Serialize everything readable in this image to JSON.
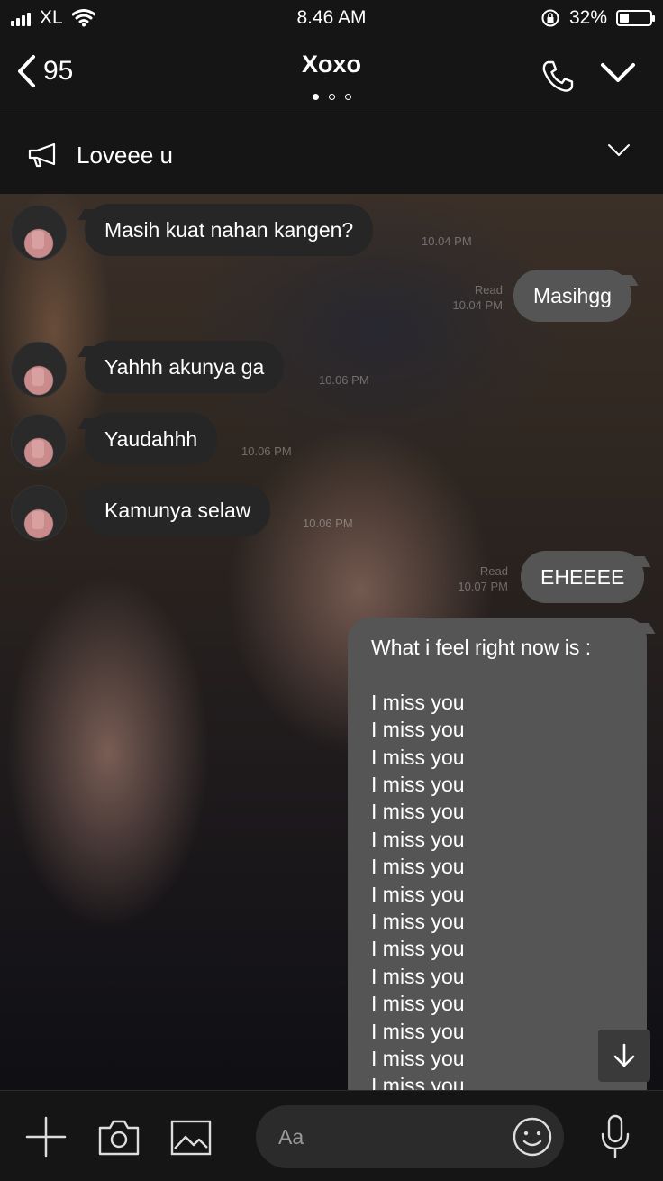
{
  "status_bar": {
    "carrier": "XL",
    "time": "8.46 AM",
    "battery_percent": "32%",
    "battery_level": 0.32
  },
  "nav": {
    "back_count": "95",
    "title": "Xoxo",
    "page_dots": 3,
    "active_dot": 0
  },
  "announcement": {
    "text": "Loveee u"
  },
  "messages": [
    {
      "side": "in",
      "text": "Masih kuat nahan kangen?",
      "time": "10.04 PM"
    },
    {
      "side": "out",
      "text": "Masihgg",
      "read": "Read",
      "time": "10.04 PM"
    },
    {
      "side": "in",
      "text": "Yahhh akunya ga",
      "time": "10.06 PM"
    },
    {
      "side": "in",
      "text": "Yaudahhh",
      "time": "10.06 PM"
    },
    {
      "side": "in",
      "text": "Kamunya selaw",
      "time": "10.06 PM"
    },
    {
      "side": "out",
      "text": "EHEEEE",
      "read": "Read",
      "time": "10.07 PM"
    }
  ],
  "long_message": {
    "first_line": "What i feel right now is :",
    "repeated_line": "I miss you",
    "lines": [
      "I miss you",
      "I miss you",
      "I miss you",
      "I miss you",
      "I miss you",
      "I miss you",
      "I miss you",
      "I miss you",
      "I miss you",
      "I miss you",
      "I miss you",
      "I miss you",
      "I miss you",
      "I miss you",
      "I miss you"
    ]
  },
  "input": {
    "placeholder": "Aa"
  },
  "icons": {
    "back": "chevron-left-icon",
    "call": "phone-icon",
    "expand": "chevron-down-icon",
    "announcement": "megaphone-icon",
    "add": "plus-icon",
    "camera": "camera-icon",
    "gallery": "image-icon",
    "emoji": "emoji-icon",
    "voice": "microphone-icon",
    "scroll": "arrow-down-icon"
  },
  "colors": {
    "bar_background": "#151515",
    "incoming_bubble": "#262626",
    "outgoing_bubble": "#555555"
  }
}
